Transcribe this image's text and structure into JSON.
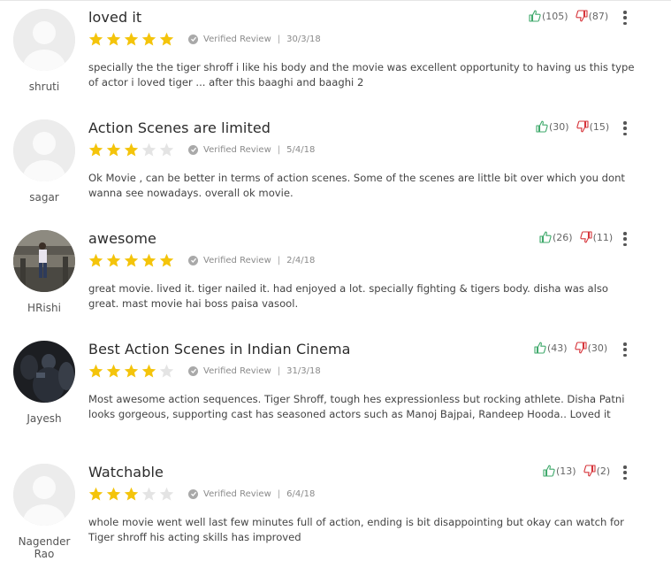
{
  "colors": {
    "star_filled": "#f4c40b",
    "star_empty": "#e4e4e4",
    "like": "#3fa96b",
    "dislike": "#d6343a"
  },
  "reviews": [
    {
      "user": "shruti",
      "title": "loved it",
      "rating": 5,
      "verified_label": "Verified Review",
      "separator": "|",
      "date": "30/3/18",
      "likes": "(105)",
      "dislikes": "(87)",
      "text": "specially the the tiger shroff i like his body and the movie was excellent opportunity to having us this type of actor i loved tiger ... after this baaghi and baaghi 2",
      "avatar": "placeholder"
    },
    {
      "user": "sagar",
      "title": "Action Scenes are limited",
      "rating": 3,
      "verified_label": "Verified Review",
      "separator": "|",
      "date": "5/4/18",
      "likes": "(30)",
      "dislikes": "(15)",
      "text": "Ok Movie , can be better in terms of action scenes. Some of the scenes are little bit over which you dont wanna see nowadays. overall ok movie.",
      "avatar": "placeholder"
    },
    {
      "user": "HRishi",
      "title": "awesome",
      "rating": 5,
      "verified_label": "Verified Review",
      "separator": "|",
      "date": "2/4/18",
      "likes": "(26)",
      "dislikes": "(11)",
      "text": "great movie. lived it. tiger nailed it. had enjoyed a lot. specially fighting & tigers body. disha was also great. mast movie hai boss paisa vasool.",
      "avatar": "photo"
    },
    {
      "user": "Jayesh",
      "title": "Best Action Scenes in Indian Cinema",
      "rating": 4,
      "verified_label": "Verified Review",
      "separator": "|",
      "date": "31/3/18",
      "likes": "(43)",
      "dislikes": "(30)",
      "text": "Most awesome action sequences. Tiger Shroff, tough hes expressionless but rocking athlete. Disha Patni looks gorgeous, supporting cast has seasoned actors such as Manoj Bajpai, Randeep Hooda.. Loved it",
      "avatar": "photo"
    },
    {
      "user": "Nagender Rao",
      "title": "Watchable",
      "rating": 3,
      "verified_label": "Verified Review",
      "separator": "|",
      "date": "6/4/18",
      "likes": "(13)",
      "dislikes": "(2)",
      "text": "whole movie went well last few minutes full of action, ending is bit disappointing but okay can watch for Tiger shroff his acting skills has improved",
      "avatar": "placeholder"
    }
  ]
}
